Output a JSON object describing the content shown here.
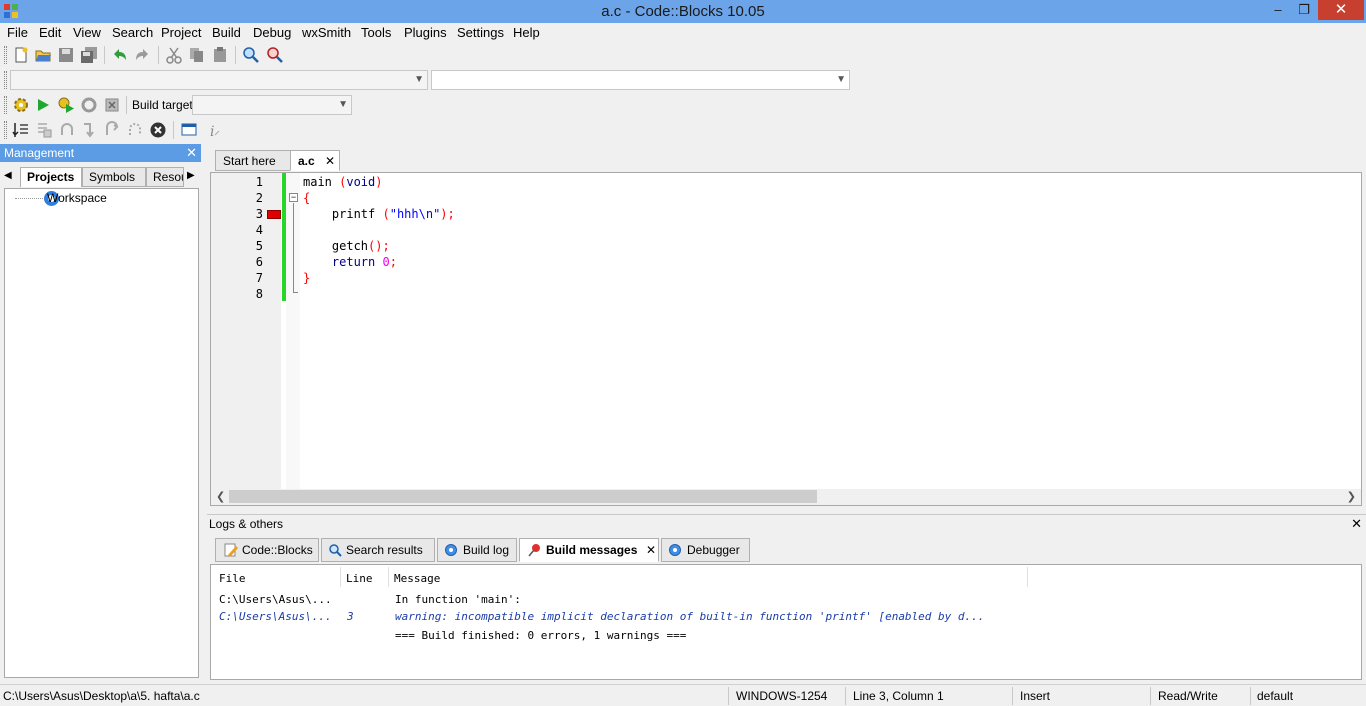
{
  "window": {
    "title": "a.c - Code::Blocks 10.05",
    "minimize": "–",
    "maximize": "❐",
    "close": "✕"
  },
  "menu": {
    "items": [
      "File",
      "Edit",
      "View",
      "Search",
      "Project",
      "Build",
      "Debug",
      "wxSmith",
      "Tools",
      "Plugins",
      "Settings",
      "Help"
    ]
  },
  "compiler_toolbar": {
    "build_target_label": "Build target:",
    "build_target_value": ""
  },
  "management": {
    "title": "Management",
    "close": "✕",
    "tabs": [
      "Projects",
      "Symbols",
      "Resou"
    ],
    "tree_root": "Workspace"
  },
  "editor": {
    "tabs": [
      {
        "label": "Start here"
      },
      {
        "label": "a.c",
        "close": "✕"
      }
    ],
    "line_numbers": [
      "1",
      "2",
      "3",
      "4",
      "5",
      "6",
      "7",
      "8"
    ],
    "fold_marker": "−",
    "lines": [
      [
        {
          "t": "main ",
          "c": ""
        },
        {
          "t": "(",
          "c": "op"
        },
        {
          "t": "void",
          "c": "kw"
        },
        {
          "t": ")",
          "c": "op"
        }
      ],
      [
        {
          "t": "{",
          "c": "op"
        }
      ],
      [
        {
          "t": "    printf ",
          "c": ""
        },
        {
          "t": "(",
          "c": "op"
        },
        {
          "t": "\"hhh\\n\"",
          "c": "str"
        },
        {
          "t": ");",
          "c": "op"
        }
      ],
      [],
      [
        {
          "t": "    getch",
          "c": ""
        },
        {
          "t": "();",
          "c": "op"
        }
      ],
      [
        {
          "t": "    ",
          "c": ""
        },
        {
          "t": "return",
          "c": "kw"
        },
        {
          "t": " ",
          "c": ""
        },
        {
          "t": "0",
          "c": "num"
        },
        {
          "t": ";",
          "c": "op"
        }
      ],
      [
        {
          "t": "}",
          "c": "op"
        }
      ],
      []
    ],
    "error_marker_line": 3
  },
  "logs": {
    "title": "Logs & others",
    "close": "✕",
    "tabs": [
      {
        "label": "Code::Blocks",
        "icon": "pencil-icon"
      },
      {
        "label": "Search results",
        "icon": "magnifier-icon"
      },
      {
        "label": "Build log",
        "icon": "gear-icon"
      },
      {
        "label": "Build messages",
        "icon": "pushpin-icon",
        "close": "✕"
      },
      {
        "label": "Debugger",
        "icon": "gear-icon"
      }
    ],
    "columns": [
      "File",
      "Line",
      "Message"
    ],
    "rows": [
      {
        "file": "C:\\Users\\Asus\\...",
        "line": "",
        "message": "In function 'main':",
        "warning": false
      },
      {
        "file": "C:\\Users\\Asus\\...",
        "line": "3",
        "message": "warning: incompatible implicit declaration of built-in function 'printf' [enabled by d...",
        "warning": true
      },
      {
        "file": "",
        "line": "",
        "message": "=== Build finished: 0 errors, 1 warnings ===",
        "warning": false
      }
    ]
  },
  "status": {
    "path": "C:\\Users\\Asus\\Desktop\\a\\5. hafta\\a.c",
    "encoding": "WINDOWS-1254",
    "position": "Line 3, Column 1",
    "mode": "Insert",
    "access": "Read/Write",
    "profile": "default"
  }
}
